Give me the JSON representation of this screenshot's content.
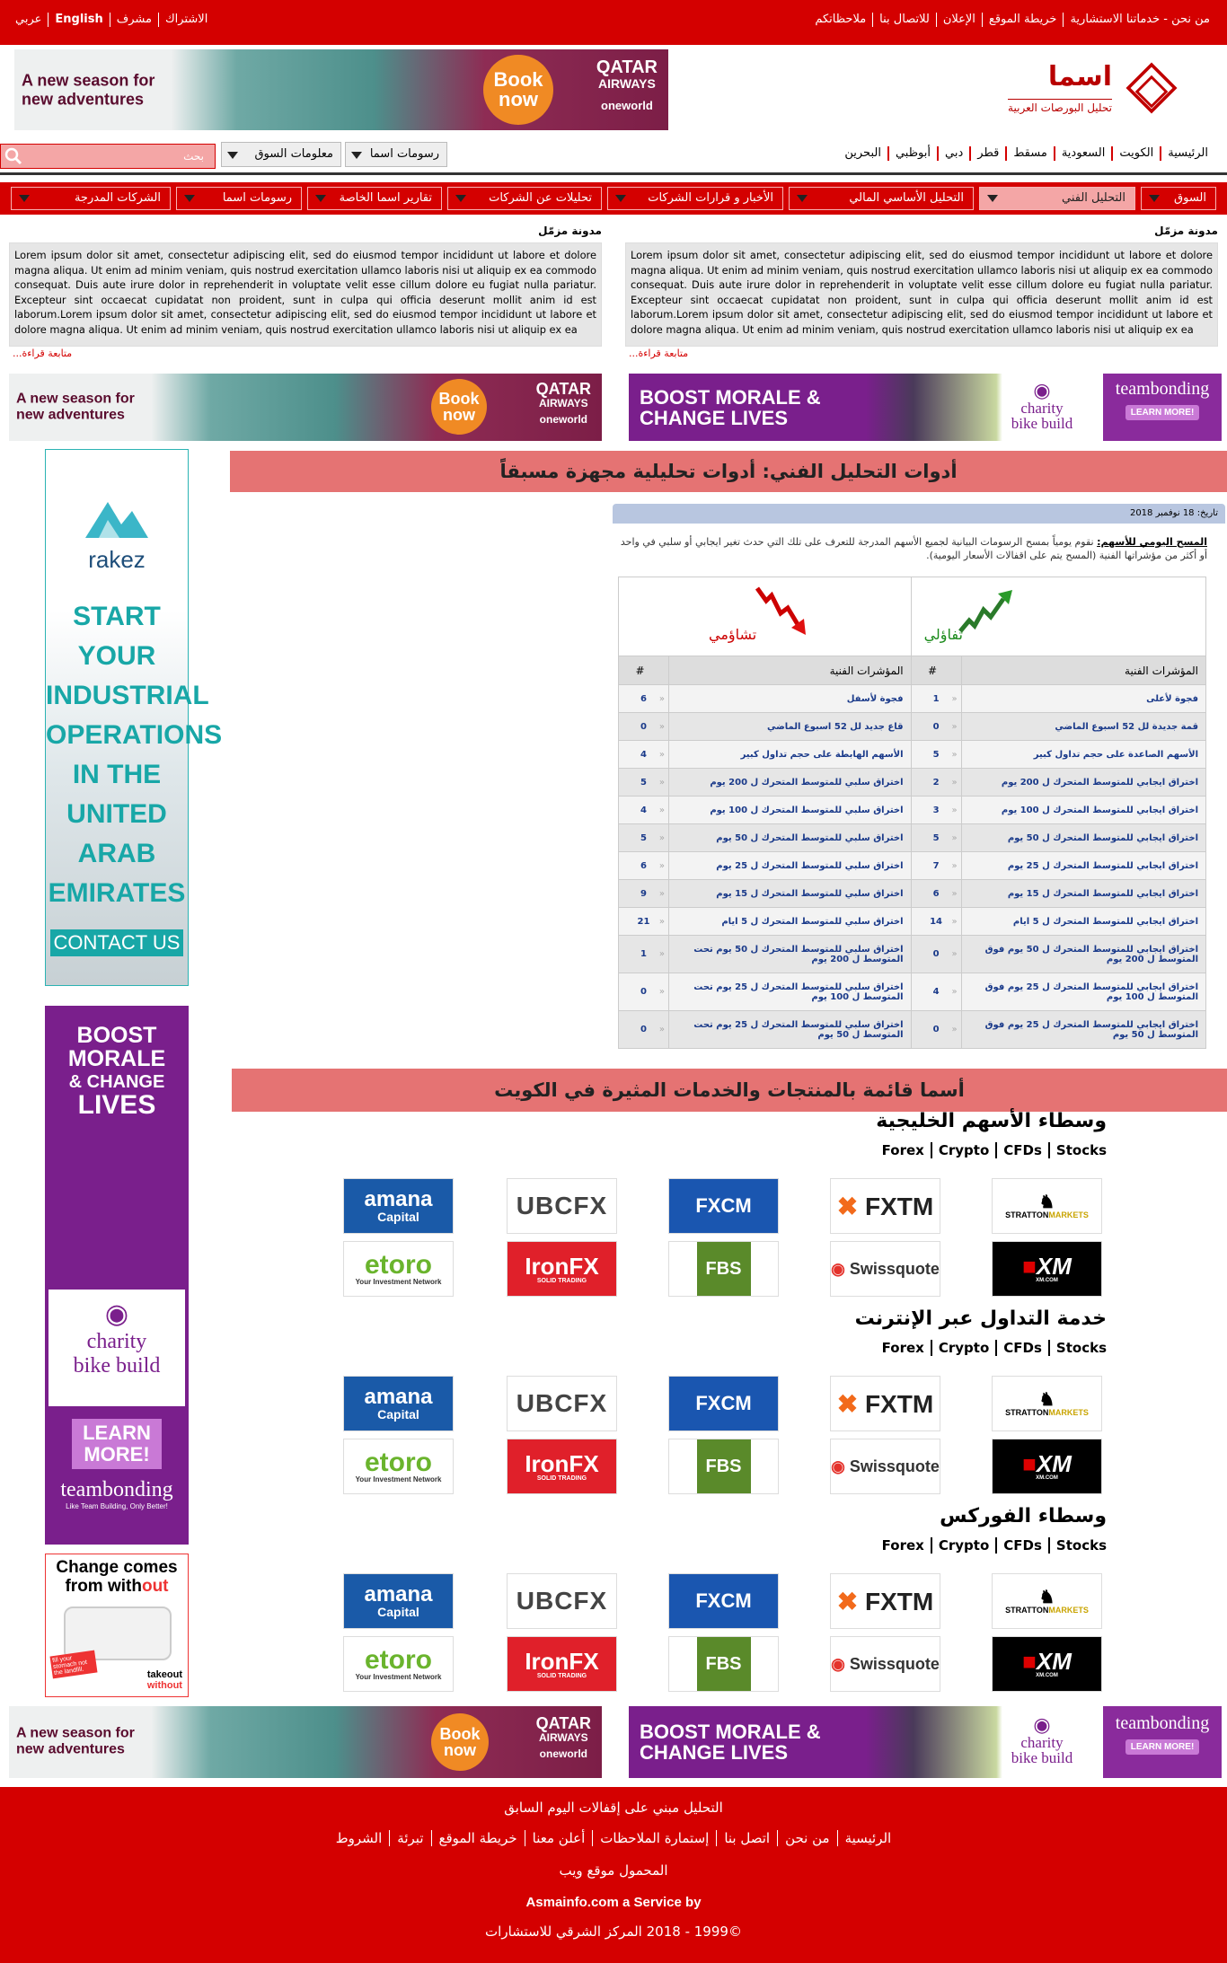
{
  "topbar": {
    "right_links": [
      "من نحن - خدماتنا الاستشارية",
      "خريطة الموقع",
      "الإعلان",
      "للاتصال بنا",
      "ملاحظاتكم"
    ],
    "left_links": [
      "الاشتراك",
      "مشرف",
      "English",
      "عربي"
    ]
  },
  "banner_qatar": {
    "text_line1": "A new season for",
    "text_line2": "new adventures",
    "book_line1": "Book",
    "book_line2": "now",
    "airline_line1": "QATAR",
    "airline_line2": "AIRWAYS",
    "alliance": "oneworld"
  },
  "banner_boost": {
    "text_line1": "BOOST MORALE &",
    "text_line2": "CHANGE LIVES",
    "charity_line1": "charity",
    "charity_line2": "bike build",
    "brand": "teambonding",
    "cta": "LEARN MORE!"
  },
  "logo": {
    "name": "اسما",
    "tagline": "تحليل البورصات العربية"
  },
  "country_nav": [
    "الرئيسية",
    "الكويت",
    "السعودية",
    "مسقط",
    "قطر",
    "دبي",
    "أبوظبي",
    "البحرين"
  ],
  "search": {
    "placeholder": "بحث"
  },
  "dropdowns": {
    "market_info": "معلومات السوق",
    "asma_charts": "رسومات اسما"
  },
  "main_nav": [
    "السوق",
    "التحليل الفني",
    "التحليل الأساسي المالي",
    "الأخبار و قرارات الشركات",
    "تحليلات عن الشركات",
    "تقارير اسما الخاصة",
    "رسومات اسما",
    "الشركات المدرجة"
  ],
  "blogs": [
    {
      "title": "مدونة مزمّل",
      "text": "Lorem ipsum dolor sit amet, consectetur adipiscing elit, sed do eiusmod tempor incididunt ut labore et dolore magna aliqua. Ut enim ad minim veniam, quis nostrud exercitation ullamco laboris nisi ut aliquip ex ea commodo consequat. Duis aute irure dolor in reprehenderit in voluptate velit esse cillum dolore eu fugiat nulla pariatur. Excepteur sint occaecat cupidatat non proident, sunt in culpa qui officia deserunt mollit anim id est laborum.Lorem ipsum dolor sit amet, consectetur adipiscing elit, sed do eiusmod tempor incididunt ut labore et dolore magna aliqua. Ut enim ad minim veniam, quis nostrud exercitation ullamco laboris nisi ut aliquip ex ea",
      "more": "متابعة قراءة..."
    },
    {
      "title": "مدونة مزمّل",
      "text": "Lorem ipsum dolor sit amet, consectetur adipiscing elit, sed do eiusmod tempor incididunt ut labore et dolore magna aliqua. Ut enim ad minim veniam, quis nostrud exercitation ullamco laboris nisi ut aliquip ex ea commodo consequat. Duis aute irure dolor in reprehenderit in voluptate velit esse cillum dolore eu fugiat nulla pariatur. Excepteur sint occaecat cupidatat non proident, sunt in culpa qui officia deserunt mollit anim id est laborum.Lorem ipsum dolor sit amet, consectetur adipiscing elit, sed do eiusmod tempor incididunt ut labore et dolore magna aliqua. Ut enim ad minim veniam, quis nostrud exercitation ullamco laboris nisi ut aliquip ex ea",
      "more": "متابعة قراءة..."
    }
  ],
  "rakez_ad": {
    "brand": "rakez",
    "line1": "START YOUR",
    "line2": "INDUSTRIAL",
    "line3": "OPERATIONS",
    "line4": "IN THE",
    "line5": "UNITED",
    "line6": "ARAB",
    "line7": "EMIRATES",
    "cta": "CONTACT US"
  },
  "side_boost": {
    "line1": "BOOST",
    "line2": "MORALE",
    "line3": "& CHANGE",
    "line4": "LIVES",
    "charity1": "charity",
    "charity2": "bike build",
    "cta1": "LEARN",
    "cta2": "MORE!",
    "brand": "teambonding",
    "tagline": "Like Team Building, Only Better!"
  },
  "takeout_ad": {
    "line1": "Change comes",
    "line2a": "from with",
    "line2b": "out",
    "badge": "fill your stomach not the landfill.",
    "brand1": "takeout",
    "brand2": "without"
  },
  "ta_section": {
    "title": "أدوات التحليل الفني: أدوات تحليلية مجهزة مسبقاً",
    "date": "تاريخ: 18 نوفمبر 2018",
    "desc_bold": "المسح اليومي للأسهم:",
    "desc_text": " نقوم يومياً بمسح الرسومات البيانية لجميع الأسهم المدرجة للتعرف على تلك التي حدث تغير ايجابي أو سلبي في واحد أو أكثر من مؤشراتها الفنية (المسح يتم على اقفالات الأسعار اليومية).",
    "bull_label": "تفاؤلي",
    "bear_label": "تشاؤمي",
    "col_indicators": "المؤشرات الفنية",
    "col_count": "#"
  },
  "ta_rows": [
    {
      "bull": "فجوة لأعلى",
      "bull_n": "1",
      "bear": "فجوة لأسفل",
      "bear_n": "6"
    },
    {
      "bull": "قمة جديدة لل 52 اسبوع الماضي",
      "bull_n": "0",
      "bear": "قاع جديد لل 52 اسبوع الماضي",
      "bear_n": "0"
    },
    {
      "bull": "الأسهم الصاعدة على حجم تداول كبير",
      "bull_n": "5",
      "bear": "الأسهم الهابطة على حجم تداول كبير",
      "bear_n": "4"
    },
    {
      "bull": "اختراق ايجابي للمتوسط المتحرك ل 200 يوم",
      "bull_n": "2",
      "bear": "اختراق سلبي للمتوسط المتحرك ل 200 يوم",
      "bear_n": "5"
    },
    {
      "bull": "اختراق ايجابي للمتوسط المتحرك ل 100 يوم",
      "bull_n": "3",
      "bear": "اختراق سلبي للمتوسط المتحرك ل 100 يوم",
      "bear_n": "4"
    },
    {
      "bull": "اختراق ايجابي للمتوسط المتحرك ل 50 يوم",
      "bull_n": "5",
      "bear": "اختراق سلبي للمتوسط المتحرك ل 50 يوم",
      "bear_n": "5"
    },
    {
      "bull": "اختراق ايجابي للمتوسط المتحرك ل 25 يوم",
      "bull_n": "7",
      "bear": "اختراق سلبي للمتوسط المتحرك ل 25 يوم",
      "bear_n": "6"
    },
    {
      "bull": "اختراق ايجابي للمتوسط المتحرك ل 15 يوم",
      "bull_n": "6",
      "bear": "اختراق سلبي للمتوسط المتحرك ل 15 يوم",
      "bear_n": "9"
    },
    {
      "bull": "اختراق ايجابي للمتوسط المتحرك ل 5 ايام",
      "bull_n": "14",
      "bear": "اختراق سلبي للمتوسط المتحرك ل 5 ايام",
      "bear_n": "21"
    },
    {
      "bull": "اختراق ايجابي للمتوسط المتحرك ل 50 يوم فوق المتوسط ل 200 يوم",
      "bull_n": "0",
      "bear": "اختراق سلبي للمتوسط المتحرك ل 50 يوم تحت المتوسط ل 200 يوم",
      "bear_n": "1"
    },
    {
      "bull": "اختراق ايجابي للمتوسط المتحرك ل 25 يوم فوق المتوسط ل 100 يوم",
      "bull_n": "4",
      "bear": "اختراق سلبي للمتوسط المتحرك ل 25 يوم تحت المتوسط ل 100 يوم",
      "bear_n": "0"
    },
    {
      "bull": "اختراق ايجابي للمتوسط المتحرك ل 25 يوم فوق المتوسط ل 50 يوم",
      "bull_n": "0",
      "bear": "اختراق سلبي للمتوسط المتحرك ل 25 يوم تحت المتوسط ل 50 يوم",
      "bear_n": "0"
    }
  ],
  "kuwait_section": {
    "title": "أسما قائمة بالمنتجات والخدمات المثيرة في الكويت"
  },
  "broker_blocks": [
    {
      "title": "وسطاء الأسهم الخليجية"
    },
    {
      "title": "خدمة التداول عبر الإنترنت"
    },
    {
      "title": "وسطاء الفوركس"
    }
  ],
  "broker_tabs": [
    "Forex",
    "Crypto",
    "CFDs",
    "Stocks"
  ],
  "broker_logos": {
    "amana1": "amana",
    "amana2": "Capital",
    "ubcfx": "UBCFX",
    "fxcm": "FXCM",
    "fxtm": "FXTM",
    "stratton": "STRATTON",
    "stratton2": "MARKETS",
    "etoro": "etoro",
    "etoro_sub": "Your Investment Network",
    "ironfx": "IronFX",
    "ironfx_sub": "SOLID TRADING",
    "fbs": "FBS",
    "swissquote": "Swissquote",
    "xm": "XM",
    "xm_sub": "XM.COM"
  },
  "footer": {
    "note": "التحليل مبني على إقفالات اليوم السابق",
    "links": [
      "الرئيسية",
      "من نحن",
      "اتصل بنا",
      "إستمارة الملاحظات",
      "أعلن معنا",
      "خريطة الموقع",
      "تبرئة",
      "الشروط"
    ],
    "mobile": "المحمول موقع ويب",
    "service": "Asmainfo.com a Service by",
    "copyright": "©1999 - 2018  المركز الشرقي للاستشارات"
  },
  "colors": {
    "brand_red": "#d40000",
    "nav_active": "#f4a6a6",
    "section_bar": "#e57373"
  }
}
